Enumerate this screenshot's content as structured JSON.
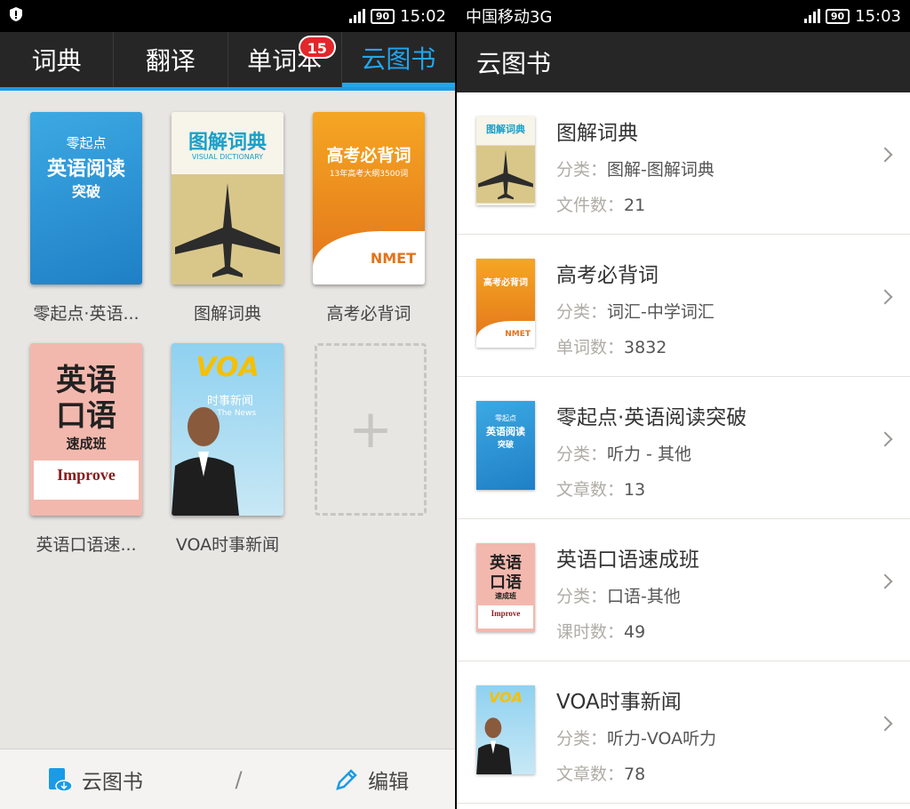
{
  "left": {
    "status": {
      "time": "15:02",
      "battery": "90"
    },
    "tabs": [
      {
        "label": "词典"
      },
      {
        "label": "翻译"
      },
      {
        "label": "单词本",
        "badge": "15"
      },
      {
        "label": "云图书"
      }
    ],
    "books": [
      {
        "title": "零起点·英语...",
        "cover": "c-reading",
        "cover_lines": [
          "零起点",
          "英语阅读",
          "突破"
        ]
      },
      {
        "title": "图解词典",
        "cover": "c-visual",
        "cover_lines": [
          "图解词典",
          "VISUAL DICTIONARY"
        ]
      },
      {
        "title": "高考必背词",
        "cover": "c-gaokao",
        "cover_lines": [
          "高考必背词",
          "13年高考大纲3500词",
          "NMET"
        ]
      },
      {
        "title": "英语口语速...",
        "cover": "c-spoken",
        "cover_lines": [
          "英语",
          "口语",
          "速成班",
          "Improve"
        ]
      },
      {
        "title": "VOA时事新闻",
        "cover": "c-voa",
        "cover_lines": [
          "VOA",
          "时事新闻",
          "In The News"
        ]
      }
    ],
    "add_symbol": "+",
    "bottom": {
      "cloud": "云图书",
      "separator": "/",
      "edit": "编辑"
    }
  },
  "right": {
    "status": {
      "carrier": "中国移动3G",
      "time": "15:03",
      "battery": "90"
    },
    "header": "云图书",
    "items": [
      {
        "name": "图解词典",
        "cat_label": "分类：",
        "cat": "图解-图解词典",
        "cnt_label": "文件数：",
        "cnt": "21",
        "cover": "c-visual"
      },
      {
        "name": "高考必背词",
        "cat_label": "分类：",
        "cat": "词汇-中学词汇",
        "cnt_label": "单词数：",
        "cnt": "3832",
        "cover": "c-gaokao"
      },
      {
        "name": "零起点·英语阅读突破",
        "cat_label": "分类：",
        "cat": "听力 - 其他",
        "cnt_label": "文章数：",
        "cnt": "13",
        "cover": "c-reading"
      },
      {
        "name": "英语口语速成班",
        "cat_label": "分类：",
        "cat": "口语-其他",
        "cnt_label": "课时数：",
        "cnt": "49",
        "cover": "c-spoken"
      },
      {
        "name": "VOA时事新闻",
        "cat_label": "分类：",
        "cat": "听力-VOA听力",
        "cnt_label": "文章数：",
        "cnt": "78",
        "cover": "c-voa"
      }
    ]
  }
}
